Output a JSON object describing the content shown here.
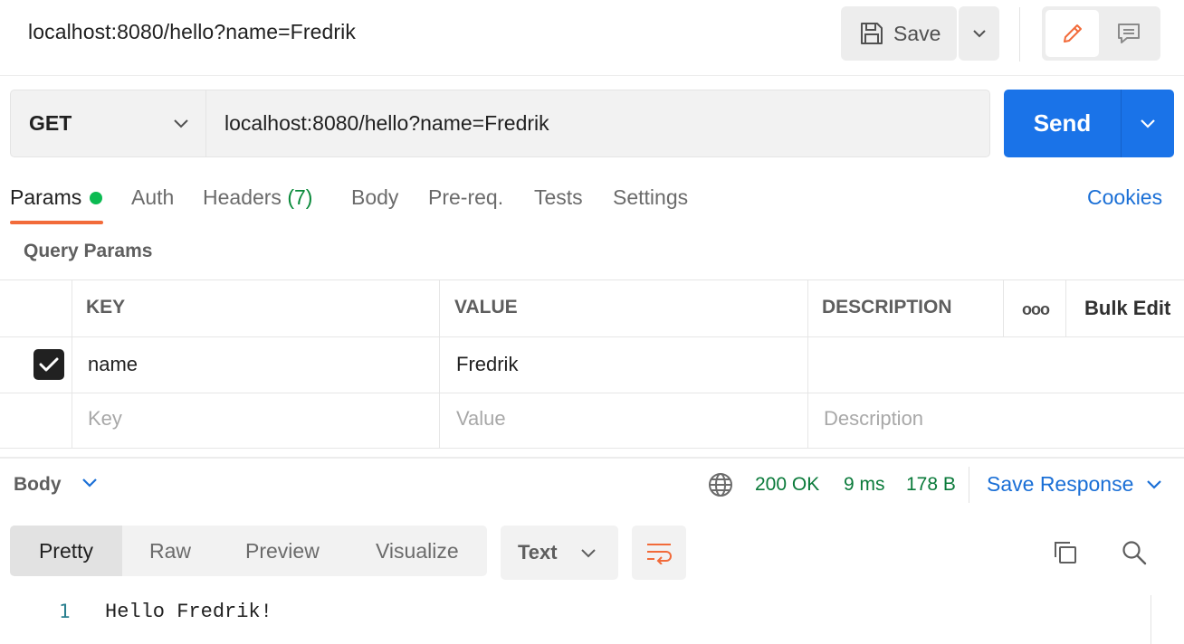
{
  "header": {
    "title": "localhost:8080/hello?name=Fredrik",
    "save_label": "Save"
  },
  "request": {
    "method": "GET",
    "url": "localhost:8080/hello?name=Fredrik",
    "send_label": "Send"
  },
  "tabs": {
    "params": "Params",
    "auth": "Auth",
    "headers": "Headers",
    "headers_count": "(7)",
    "body": "Body",
    "prereq": "Pre-req.",
    "tests": "Tests",
    "settings": "Settings",
    "cookies": "Cookies"
  },
  "query_params": {
    "label": "Query Params",
    "columns": [
      "KEY",
      "VALUE",
      "DESCRIPTION"
    ],
    "more": "ooo",
    "bulk_edit": "Bulk Edit",
    "rows": [
      {
        "checked": true,
        "key": "name",
        "value": "Fredrik",
        "description": ""
      }
    ],
    "placeholders": {
      "key": "Key",
      "value": "Value",
      "description": "Description"
    }
  },
  "response": {
    "body_label": "Body",
    "status": "200 OK",
    "time": "9 ms",
    "size": "178 B",
    "save_response": "Save Response",
    "views": [
      "Pretty",
      "Raw",
      "Preview",
      "Visualize"
    ],
    "format": "Text",
    "lines": [
      {
        "number": "1",
        "text": "Hello Fredrik!"
      }
    ]
  },
  "colors": {
    "accent_orange": "#f26b3a",
    "send_blue": "#1a73e8",
    "link_blue": "#1a6fd6",
    "status_green": "#0a7a3a",
    "params_dot": "#0cbb52"
  }
}
